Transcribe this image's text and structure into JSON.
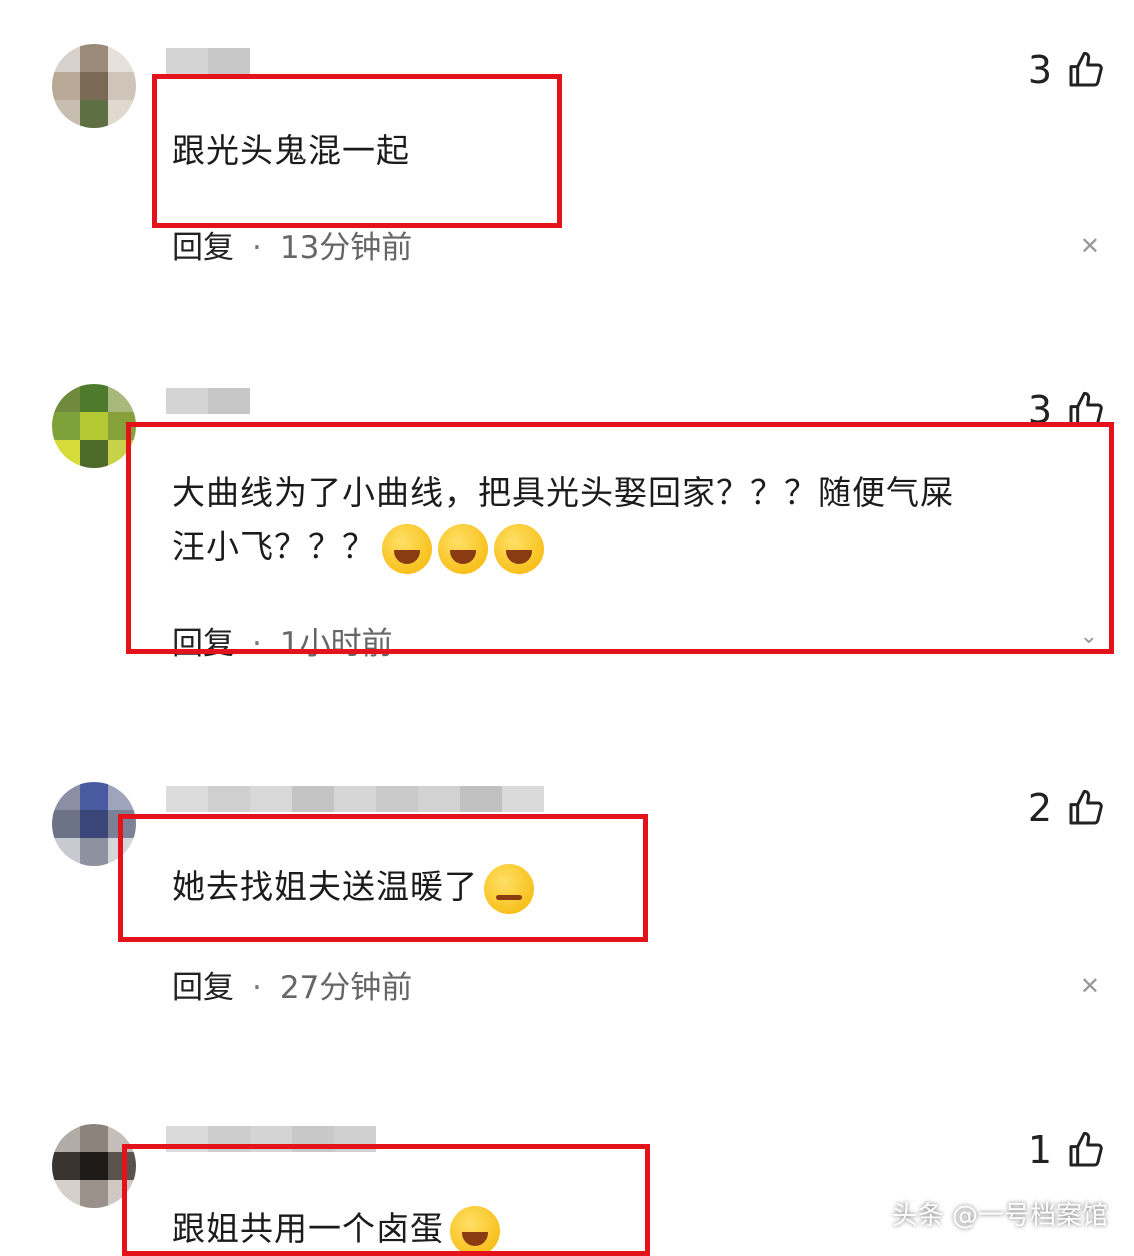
{
  "comments": [
    {
      "text": "跟光头鬼混一起",
      "likes": "3",
      "reply_label": "回复",
      "separator": "·",
      "time": "13分钟前"
    },
    {
      "text_line1": "大曲线为了小曲线，把具光头娶回家？？？随便气屎",
      "text_line2": "汪小飞？？？",
      "likes": "3",
      "reply_label": "回复",
      "separator": "·",
      "time": "1小时前"
    },
    {
      "text": "她去找姐夫送温暖了",
      "likes": "2",
      "reply_label": "回复",
      "separator": "·",
      "time": "27分钟前"
    },
    {
      "text": "跟姐共用一个卤蛋",
      "likes": "1"
    }
  ],
  "icons": {
    "like": "thumbs-up-icon",
    "close": "close-icon",
    "expand": "chevron-down-icon",
    "emoji_laugh": "laugh-cry-emoji",
    "emoji_wink": "smirk-emoji",
    "emoji_grin": "grin-emoji"
  },
  "colors": {
    "highlight_box": "#e3121b",
    "background": "#ffffff"
  },
  "watermark": "头条 @一号档案馆"
}
